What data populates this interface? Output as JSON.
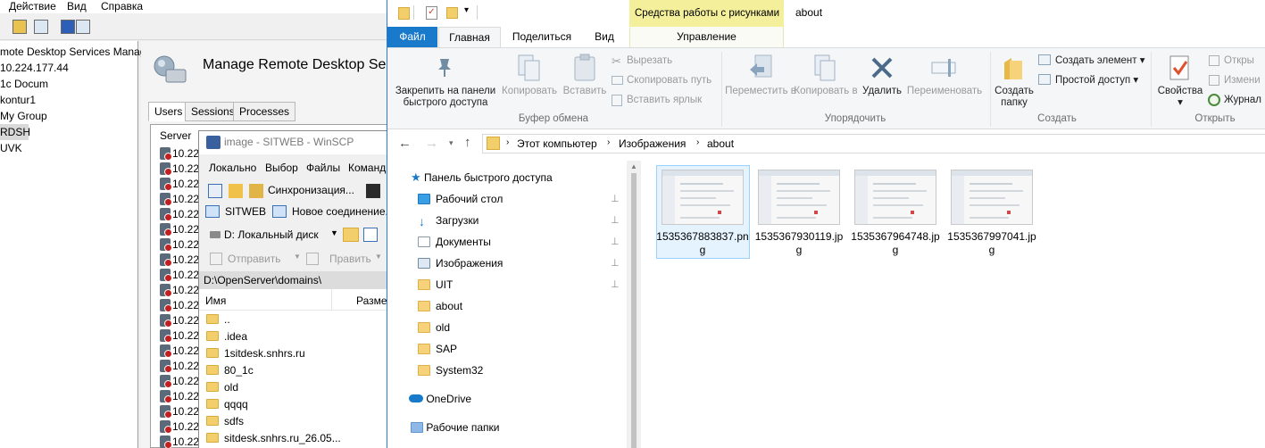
{
  "rds": {
    "menu": [
      "Действие",
      "Вид",
      "Справка"
    ],
    "tree": [
      "mote Desktop Services Manag",
      "10.224.177.44",
      "1c Docum",
      "kontur1",
      "My Group",
      "RDSH",
      "UVK"
    ],
    "title": "Manage Remote Desktop Se",
    "tabs": [
      "Users",
      "Sessions",
      "Processes"
    ],
    "list_header": "Server",
    "server_prefix": "10.22"
  },
  "winscp": {
    "title": "image - SITWEB - WinSCP",
    "menu": [
      "Локально",
      "Выбор",
      "Файлы",
      "Команд"
    ],
    "sync_label": "Синхронизация...",
    "session_tab": "SITWEB",
    "new_session": "Новое соединение...",
    "drive": "D: Локальный диск",
    "send_label": "Отправить",
    "edit_label": "Править",
    "path": "D:\\OpenServer\\domains\\",
    "col_name": "Имя",
    "col_size": "Размер",
    "files": [
      "..",
      ".idea",
      "1sitdesk.snhrs.ru",
      "80_1c",
      "old",
      "qqqq",
      "sdfs",
      "sitdesk.snhrs.ru_26.05..."
    ]
  },
  "explorer": {
    "ctx_tab": "Средства работы с рисунками",
    "window_title": "about",
    "tabs": {
      "file": "Файл",
      "home": "Главная",
      "share": "Поделиться",
      "view": "Вид",
      "manage": "Управление"
    },
    "ribbon": {
      "pin": "Закрепить на панели быстрого доступа",
      "copy": "Копировать",
      "paste": "Вставить",
      "cut": "Вырезать",
      "copy_path": "Скопировать путь",
      "paste_shortcut": "Вставить ярлык",
      "clipboard_group": "Буфер обмена",
      "move_to": "Переместить в",
      "copy_to": "Копировать в",
      "delete": "Удалить",
      "rename": "Переименовать",
      "organize_group": "Упорядочить",
      "new_folder": "Создать папку",
      "new_item": "Создать элемент",
      "easy_access": "Простой доступ",
      "create_group": "Создать",
      "properties": "Свойства",
      "open": "Откры",
      "edit": "Измени",
      "history": "Журнал",
      "open_group": "Открыть"
    },
    "breadcrumb": [
      "Этот компьютер",
      "Изображения",
      "about"
    ],
    "nav": {
      "quick_access": "Панель быстрого доступа",
      "items": [
        "Рабочий стол",
        "Загрузки",
        "Документы",
        "Изображения",
        "UIT",
        "about",
        "old",
        "SAP",
        "System32"
      ],
      "onedrive": "OneDrive",
      "work_folders": "Рабочие папки"
    },
    "files": [
      {
        "name": "1535367883837.png"
      },
      {
        "name": "1535367930119.jpg"
      },
      {
        "name": "1535367964748.jpg"
      },
      {
        "name": "1535367997041.jpg"
      }
    ]
  },
  "colors": {
    "file_tab": "#1979ca",
    "context_tab": "#f3ef9a",
    "selection": "#cce8ff"
  }
}
